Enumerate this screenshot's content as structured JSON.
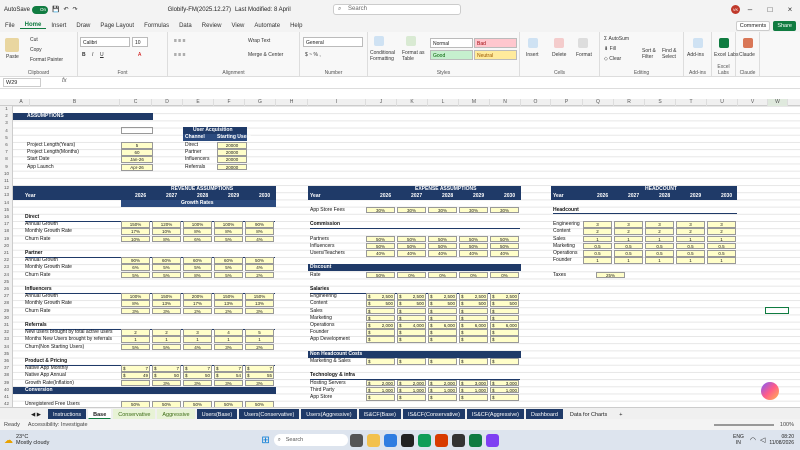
{
  "titlebar": {
    "autosave": "AutoSave",
    "autosave_state": "On",
    "filename": "Globify-FM(2025.12.27)",
    "modified": "Last Modified: 8 April",
    "search_placeholder": "Search",
    "user_initials": "VK"
  },
  "menu": [
    "File",
    "Home",
    "Insert",
    "Draw",
    "Page Layout",
    "Formulas",
    "Data",
    "Review",
    "View",
    "Automate",
    "Help"
  ],
  "menu_right": {
    "comments": "Comments",
    "share": "Share"
  },
  "ribbon": {
    "clipboard": {
      "label": "Clipboard",
      "paste": "Paste",
      "cut": "Cut",
      "copy": "Copy",
      "format_painter": "Format Painter"
    },
    "font": {
      "label": "Font",
      "name": "Calibri",
      "size": "10"
    },
    "alignment": {
      "label": "Alignment",
      "wrap": "Wrap Text",
      "merge": "Merge & Center"
    },
    "number": {
      "label": "Number",
      "format": "General"
    },
    "styles": {
      "label": "Styles",
      "cond": "Conditional Formatting",
      "table": "Format as Table",
      "normal": "Normal",
      "bad": "Bad",
      "good": "Good",
      "neutral": "Neutral"
    },
    "cells": {
      "label": "Cells",
      "insert": "Insert",
      "delete": "Delete",
      "format": "Format"
    },
    "editing": {
      "label": "Editing",
      "autosum": "AutoSum",
      "fill": "Fill",
      "clear": "Clear",
      "sort": "Sort & Filter",
      "find": "Find & Select"
    },
    "addins": {
      "label": "Add-ins",
      "addins": "Add-ins"
    },
    "excellabs": {
      "label": "Excel Labs",
      "name": "Excel Labs"
    },
    "claude": {
      "label": "Claude",
      "name": "Claude"
    }
  },
  "formula": {
    "namebox": "W29",
    "fx": "fx"
  },
  "columns": [
    "A",
    "B",
    "C",
    "D",
    "E",
    "F",
    "G",
    "H",
    "I",
    "J",
    "K",
    "L",
    "M",
    "N",
    "O",
    "P",
    "Q",
    "R",
    "S",
    "T",
    "U",
    "V",
    "W"
  ],
  "sheet": {
    "assumptions": "ASSUMPTIONS",
    "project_years_label": "Project Length(Years)",
    "project_years": "5",
    "project_months_label": "Project Length(Months)",
    "project_months": "60",
    "start_label": "Start Date",
    "start": "Jan-26",
    "launch_label": "App Launch",
    "launch": "Apr-26",
    "ua_title": "User Acquisition",
    "ua_channel": "Channel",
    "ua_starting": "Starting Users",
    "ua_rows": [
      [
        "Direct",
        "20000"
      ],
      [
        "Partner",
        "20000"
      ],
      [
        "Influencers",
        "20000"
      ],
      [
        "Referrals",
        "20000"
      ]
    ],
    "rev_title": "REVENUE ASSUMPTIONS",
    "year": "Year",
    "years": [
      "2026",
      "2027",
      "2028",
      "2029",
      "2030"
    ],
    "growth_rates": "Growth Rates",
    "direct": "Direct",
    "partner": "Partner",
    "influencers": "Influencers",
    "referrals": "Referrals",
    "annual_growth": "Annual Growth",
    "monthly_growth": "Monthly Growth Rate",
    "churn": "Churn Rate",
    "direct_vals": [
      [
        "150%",
        "120%",
        "100%",
        "100%",
        "90%"
      ],
      [
        "17%",
        "10%",
        "8%",
        "8%",
        "8%"
      ],
      [
        "10%",
        "8%",
        "6%",
        "5%",
        "4%"
      ]
    ],
    "partner_vals": [
      [
        "90%",
        "60%",
        "60%",
        "60%",
        "50%"
      ],
      [
        "6%",
        "5%",
        "5%",
        "5%",
        "4%"
      ],
      [
        "5%",
        "5%",
        "8%",
        "5%",
        "2%"
      ]
    ],
    "infl_vals": [
      [
        "100%",
        "150%",
        "200%",
        "150%",
        "150%"
      ],
      [
        "8%",
        "13%",
        "17%",
        "13%",
        "13%"
      ],
      [
        "3%",
        "3%",
        "2%",
        "2%",
        "3%"
      ]
    ],
    "ref_labels": [
      "New users brought by total active users",
      "Months New Users brought by referrals",
      "Churn(Non Starting Users)"
    ],
    "ref_vals": [
      [
        "2",
        "2",
        "3",
        "4",
        "5"
      ],
      [
        "1",
        "1",
        "1",
        "1",
        "1"
      ],
      [
        "5%",
        "5%",
        "4%",
        "3%",
        "2%"
      ]
    ],
    "product_title": "Product & Pricing",
    "price_labels": [
      "Native App Monthly",
      "Native App Annual",
      "Growth Rate(Inflation)"
    ],
    "price_vals": [
      [
        "7",
        "7",
        "7",
        "7",
        "7"
      ],
      [
        "49",
        "50",
        "50",
        "54",
        "55"
      ],
      [
        "",
        "3%",
        "3%",
        "3%",
        "3%"
      ]
    ],
    "conversion": "Conversion",
    "unreg": "Unregistered Free Users",
    "unreg_vals": [
      "50%",
      "50%",
      "50%",
      "50%",
      "50%"
    ],
    "exp_title": "EXPENSE ASSUMPTIONS",
    "app_store_fees": "App Store Fees",
    "asf_vals": [
      "30%",
      "30%",
      "30%",
      "30%",
      "30%"
    ],
    "commission": "Commission",
    "comm_labels": [
      "Partners",
      "Influencers",
      "Users/Teachers"
    ],
    "comm_vals": [
      [
        "50%",
        "50%",
        "50%",
        "50%",
        "50%"
      ],
      [
        "50%",
        "50%",
        "50%",
        "50%",
        "50%"
      ],
      [
        "40%",
        "40%",
        "40%",
        "40%",
        "40%"
      ]
    ],
    "discount": "Discount",
    "rate": "Rate",
    "rate_vals": [
      "50%",
      "0%",
      "0%",
      "0%",
      "0%"
    ],
    "salaries": "Salaries",
    "sal_labels": [
      "Engineering",
      "Content",
      "Sales",
      "Marketing",
      "Operations",
      "Founder",
      "App Development"
    ],
    "sal_vals": [
      [
        "2,500",
        "2,500",
        "2,500",
        "2,500",
        "2,500"
      ],
      [
        "500",
        "500",
        "500",
        "500",
        "500"
      ],
      [
        "",
        "",
        "",
        "",
        ""
      ],
      [
        "",
        "",
        "",
        "",
        ""
      ],
      [
        "2,000",
        "4,000",
        "6,000",
        "6,000",
        "6,000"
      ],
      [
        "",
        "",
        "",
        "",
        ""
      ],
      [
        "",
        "",
        "",
        "",
        ""
      ]
    ],
    "nonhead": "Non Headcount Costs",
    "mkt_sales": "Marketing & Sales",
    "tech": "Technology & infra",
    "tech_labels": [
      "Hosting Servers",
      "Third Party",
      "App Store"
    ],
    "tech_vals": [
      [
        "2,000",
        "2,000",
        "2,000",
        "3,000",
        "3,000"
      ],
      [
        "1,000",
        "1,000",
        "1,000",
        "1,000",
        "1,000"
      ],
      [
        "",
        "",
        "",
        "",
        ""
      ]
    ],
    "hc_title": "HEADCOUNT",
    "headcount": "Headcount",
    "hc_labels": [
      "Engineering",
      "Content",
      "Sales",
      "Marketing",
      "Operations",
      "Founder"
    ],
    "hc_vals": [
      [
        "3",
        "3",
        "3",
        "3",
        "3"
      ],
      [
        "2",
        "2",
        "2",
        "2",
        "2"
      ],
      [
        "1",
        "1",
        "1",
        "1",
        "1"
      ],
      [
        "0.5",
        "0.5",
        "0.5",
        "0.5",
        "0.5"
      ],
      [
        "0.5",
        "0.5",
        "0.5",
        "0.5",
        "0.5"
      ],
      [
        "1",
        "1",
        "1",
        "1",
        "1"
      ]
    ],
    "taxes": "Taxes",
    "taxes_val": "25%",
    "currency": "$"
  },
  "tabs": [
    "Instructions",
    "Base",
    "Conservative",
    "Aggressive",
    "Users(Base)",
    "Users(Conservative)",
    "Users(Aggressive)",
    "IS&CF(Base)",
    "IS&CF(Conservative)",
    "IS&CF(Aggressive)",
    "Dashboard",
    "Data for Charts",
    "+"
  ],
  "status": {
    "ready": "Ready",
    "accessibility": "Accessibility: Investigate",
    "zoom": "100%"
  },
  "taskbar": {
    "temp": "23°C",
    "weather": "Mostly cloudy",
    "search": "Search",
    "lang": "ENG",
    "region": "IN",
    "time": "08:20",
    "date": "11/08/2026"
  }
}
